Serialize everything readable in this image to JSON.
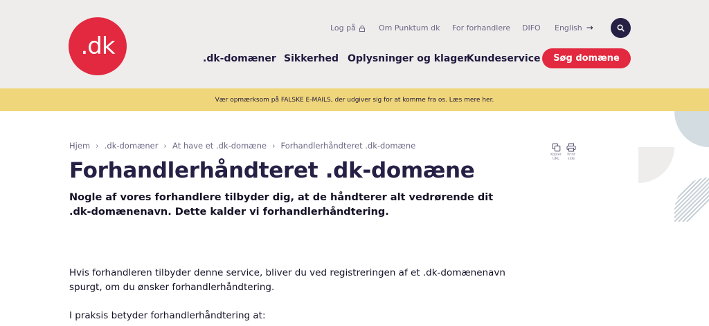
{
  "logo": {
    "text": ".dk"
  },
  "topnav": {
    "login": "Log på",
    "about": "Om Punktum dk",
    "resellers": "For forhandlere",
    "difo": "DIFO",
    "language": "English"
  },
  "mainnav": {
    "domains": ".dk-domæner",
    "security": "Sikkerhed",
    "info": "Oplysninger og klager",
    "service": "Kundeservice",
    "search_cta": "Søg domæne"
  },
  "banner": {
    "text": "Vær opmærksom på FALSKE E-MAILS, der udgiver sig for at komme fra os. Læs mere her."
  },
  "breadcrumb": {
    "items": [
      "Hjem",
      ".dk-domæner",
      "At have et .dk-domæne",
      "Forhandlerhåndteret .dk-domæne"
    ]
  },
  "tools": {
    "copy_label_1": "Kopier",
    "copy_label_2": "URL",
    "print_label_1": "Print",
    "print_label_2": "side"
  },
  "page": {
    "title": "Forhandlerhåndteret .dk-domæne",
    "lead": "Nogle af vores forhandlere tilbyder dig, at de håndterer alt vedrørende dit .dk-domænenavn. Dette kalder vi forhandlerhåndtering.",
    "p1": "Hvis forhandleren tilbyder denne service, bliver du ved registreringen af et .dk-domænenavn spurgt, om du ønsker forhandlerhåndtering.",
    "p2": "I praksis betyder forhandlerhåndtering at:"
  },
  "colors": {
    "brand_red": "#e2293f",
    "navy": "#262045",
    "banner_yellow": "#f0d67a",
    "header_bg": "#efedec"
  },
  "icons": [
    "lock-icon",
    "arrow-right-icon",
    "search-icon",
    "copy-icon",
    "print-icon"
  ]
}
